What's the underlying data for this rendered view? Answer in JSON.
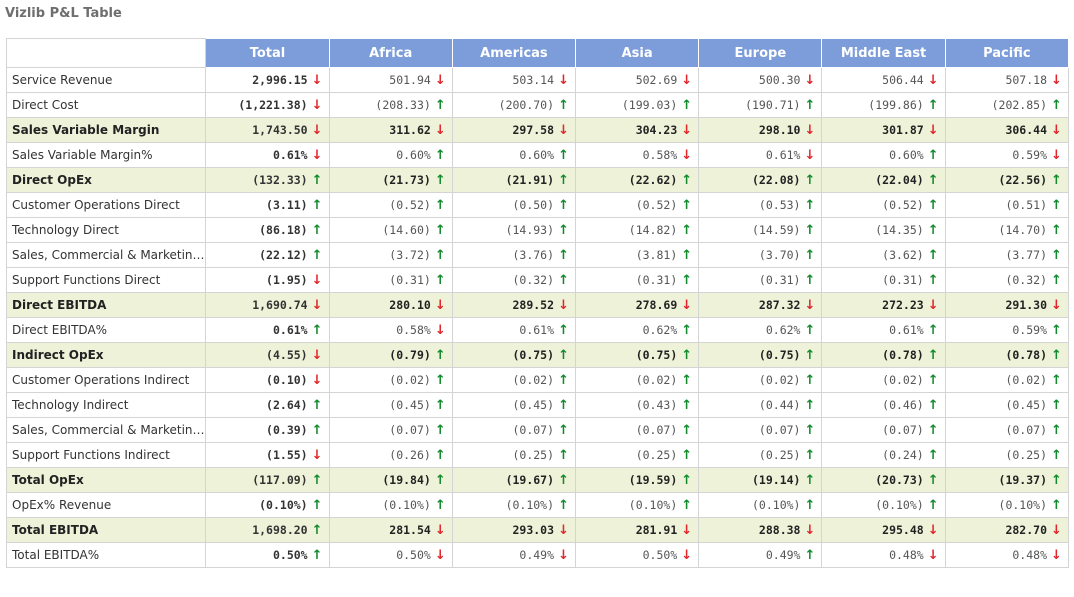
{
  "title": "Vizlib P&L Table",
  "colors": {
    "header_bg": "#7c9dd9",
    "highlight_bg": "#eef2d9",
    "up": "#118a2b",
    "down": "#e0262a"
  },
  "columns": [
    "Total",
    "Africa",
    "Americas",
    "Asia",
    "Europe",
    "Middle East",
    "Pacific"
  ],
  "rows": [
    {
      "label": "Service Revenue",
      "bold": false,
      "hl": false,
      "cells": [
        [
          "2,996.15",
          "down"
        ],
        [
          "501.94",
          "down"
        ],
        [
          "503.14",
          "down"
        ],
        [
          "502.69",
          "down"
        ],
        [
          "500.30",
          "down"
        ],
        [
          "506.44",
          "down"
        ],
        [
          "507.18",
          "down"
        ]
      ]
    },
    {
      "label": "Direct Cost",
      "bold": false,
      "hl": false,
      "cells": [
        [
          "(1,221.38)",
          "down"
        ],
        [
          "(208.33)",
          "up"
        ],
        [
          "(200.70)",
          "up"
        ],
        [
          "(199.03)",
          "up"
        ],
        [
          "(190.71)",
          "up"
        ],
        [
          "(199.86)",
          "up"
        ],
        [
          "(202.85)",
          "up"
        ]
      ]
    },
    {
      "label": "Sales Variable Margin",
      "bold": true,
      "hl": true,
      "cells": [
        [
          "1,743.50",
          "down"
        ],
        [
          "311.62",
          "down"
        ],
        [
          "297.58",
          "down"
        ],
        [
          "304.23",
          "down"
        ],
        [
          "298.10",
          "down"
        ],
        [
          "301.87",
          "down"
        ],
        [
          "306.44",
          "down"
        ]
      ]
    },
    {
      "label": "Sales Variable Margin%",
      "bold": false,
      "hl": false,
      "cells": [
        [
          "0.61%",
          "down"
        ],
        [
          "0.60%",
          "up"
        ],
        [
          "0.60%",
          "up"
        ],
        [
          "0.58%",
          "down"
        ],
        [
          "0.61%",
          "down"
        ],
        [
          "0.60%",
          "up"
        ],
        [
          "0.59%",
          "down"
        ]
      ]
    },
    {
      "label": "Direct OpEx",
      "bold": true,
      "hl": true,
      "cells": [
        [
          "(132.33)",
          "up"
        ],
        [
          "(21.73)",
          "up"
        ],
        [
          "(21.91)",
          "up"
        ],
        [
          "(22.62)",
          "up"
        ],
        [
          "(22.08)",
          "up"
        ],
        [
          "(22.04)",
          "up"
        ],
        [
          "(22.56)",
          "up"
        ]
      ]
    },
    {
      "label": "Customer Operations Direct",
      "bold": false,
      "hl": false,
      "cells": [
        [
          "(3.11)",
          "up"
        ],
        [
          "(0.52)",
          "up"
        ],
        [
          "(0.50)",
          "up"
        ],
        [
          "(0.52)",
          "up"
        ],
        [
          "(0.53)",
          "up"
        ],
        [
          "(0.52)",
          "up"
        ],
        [
          "(0.51)",
          "up"
        ]
      ]
    },
    {
      "label": "Technology Direct",
      "bold": false,
      "hl": false,
      "cells": [
        [
          "(86.18)",
          "up"
        ],
        [
          "(14.60)",
          "up"
        ],
        [
          "(14.93)",
          "up"
        ],
        [
          "(14.82)",
          "up"
        ],
        [
          "(14.59)",
          "up"
        ],
        [
          "(14.35)",
          "up"
        ],
        [
          "(14.70)",
          "up"
        ]
      ]
    },
    {
      "label": "Sales, Commercial & Marketing ...",
      "bold": false,
      "hl": false,
      "cells": [
        [
          "(22.12)",
          "up"
        ],
        [
          "(3.72)",
          "up"
        ],
        [
          "(3.76)",
          "up"
        ],
        [
          "(3.81)",
          "up"
        ],
        [
          "(3.70)",
          "up"
        ],
        [
          "(3.62)",
          "up"
        ],
        [
          "(3.77)",
          "up"
        ]
      ]
    },
    {
      "label": "Support Functions Direct",
      "bold": false,
      "hl": false,
      "cells": [
        [
          "(1.95)",
          "down"
        ],
        [
          "(0.31)",
          "up"
        ],
        [
          "(0.32)",
          "up"
        ],
        [
          "(0.31)",
          "up"
        ],
        [
          "(0.31)",
          "up"
        ],
        [
          "(0.31)",
          "up"
        ],
        [
          "(0.32)",
          "up"
        ]
      ]
    },
    {
      "label": "Direct EBITDA",
      "bold": true,
      "hl": true,
      "cells": [
        [
          "1,690.74",
          "down"
        ],
        [
          "280.10",
          "down"
        ],
        [
          "289.52",
          "down"
        ],
        [
          "278.69",
          "down"
        ],
        [
          "287.32",
          "down"
        ],
        [
          "272.23",
          "down"
        ],
        [
          "291.30",
          "down"
        ]
      ]
    },
    {
      "label": "Direct EBITDA%",
      "bold": false,
      "hl": false,
      "cells": [
        [
          "0.61%",
          "up"
        ],
        [
          "0.58%",
          "down"
        ],
        [
          "0.61%",
          "up"
        ],
        [
          "0.62%",
          "up"
        ],
        [
          "0.62%",
          "up"
        ],
        [
          "0.61%",
          "up"
        ],
        [
          "0.59%",
          "up"
        ]
      ]
    },
    {
      "label": "Indirect OpEx",
      "bold": true,
      "hl": true,
      "cells": [
        [
          "(4.55)",
          "down"
        ],
        [
          "(0.79)",
          "up"
        ],
        [
          "(0.75)",
          "up"
        ],
        [
          "(0.75)",
          "up"
        ],
        [
          "(0.75)",
          "up"
        ],
        [
          "(0.78)",
          "up"
        ],
        [
          "(0.78)",
          "up"
        ]
      ]
    },
    {
      "label": "Customer Operations Indirect",
      "bold": false,
      "hl": false,
      "cells": [
        [
          "(0.10)",
          "down"
        ],
        [
          "(0.02)",
          "up"
        ],
        [
          "(0.02)",
          "up"
        ],
        [
          "(0.02)",
          "up"
        ],
        [
          "(0.02)",
          "up"
        ],
        [
          "(0.02)",
          "up"
        ],
        [
          "(0.02)",
          "up"
        ]
      ]
    },
    {
      "label": "Technology Indirect",
      "bold": false,
      "hl": false,
      "cells": [
        [
          "(2.64)",
          "up"
        ],
        [
          "(0.45)",
          "up"
        ],
        [
          "(0.45)",
          "up"
        ],
        [
          "(0.43)",
          "up"
        ],
        [
          "(0.44)",
          "up"
        ],
        [
          "(0.46)",
          "up"
        ],
        [
          "(0.45)",
          "up"
        ]
      ]
    },
    {
      "label": "Sales, Commercial & Marketing ...",
      "bold": false,
      "hl": false,
      "cells": [
        [
          "(0.39)",
          "up"
        ],
        [
          "(0.07)",
          "up"
        ],
        [
          "(0.07)",
          "up"
        ],
        [
          "(0.07)",
          "up"
        ],
        [
          "(0.07)",
          "up"
        ],
        [
          "(0.07)",
          "up"
        ],
        [
          "(0.07)",
          "up"
        ]
      ]
    },
    {
      "label": "Support Functions Indirect",
      "bold": false,
      "hl": false,
      "cells": [
        [
          "(1.55)",
          "down"
        ],
        [
          "(0.26)",
          "up"
        ],
        [
          "(0.25)",
          "up"
        ],
        [
          "(0.25)",
          "up"
        ],
        [
          "(0.25)",
          "up"
        ],
        [
          "(0.24)",
          "up"
        ],
        [
          "(0.25)",
          "up"
        ]
      ]
    },
    {
      "label": "Total OpEx",
      "bold": true,
      "hl": true,
      "cells": [
        [
          "(117.09)",
          "up"
        ],
        [
          "(19.84)",
          "up"
        ],
        [
          "(19.67)",
          "up"
        ],
        [
          "(19.59)",
          "up"
        ],
        [
          "(19.14)",
          "up"
        ],
        [
          "(20.73)",
          "up"
        ],
        [
          "(19.37)",
          "up"
        ]
      ]
    },
    {
      "label": "OpEx% Revenue",
      "bold": false,
      "hl": false,
      "cells": [
        [
          "(0.10%)",
          "up"
        ],
        [
          "(0.10%)",
          "up"
        ],
        [
          "(0.10%)",
          "up"
        ],
        [
          "(0.10%)",
          "up"
        ],
        [
          "(0.10%)",
          "up"
        ],
        [
          "(0.10%)",
          "up"
        ],
        [
          "(0.10%)",
          "up"
        ]
      ]
    },
    {
      "label": "Total EBITDA",
      "bold": true,
      "hl": true,
      "cells": [
        [
          "1,698.20",
          "up"
        ],
        [
          "281.54",
          "down"
        ],
        [
          "293.03",
          "down"
        ],
        [
          "281.91",
          "down"
        ],
        [
          "288.38",
          "down"
        ],
        [
          "295.48",
          "down"
        ],
        [
          "282.70",
          "down"
        ]
      ]
    },
    {
      "label": "Total EBITDA%",
      "bold": false,
      "hl": false,
      "cells": [
        [
          "0.50%",
          "up"
        ],
        [
          "0.50%",
          "down"
        ],
        [
          "0.49%",
          "down"
        ],
        [
          "0.50%",
          "down"
        ],
        [
          "0.49%",
          "up"
        ],
        [
          "0.48%",
          "down"
        ],
        [
          "0.48%",
          "down"
        ]
      ]
    }
  ]
}
